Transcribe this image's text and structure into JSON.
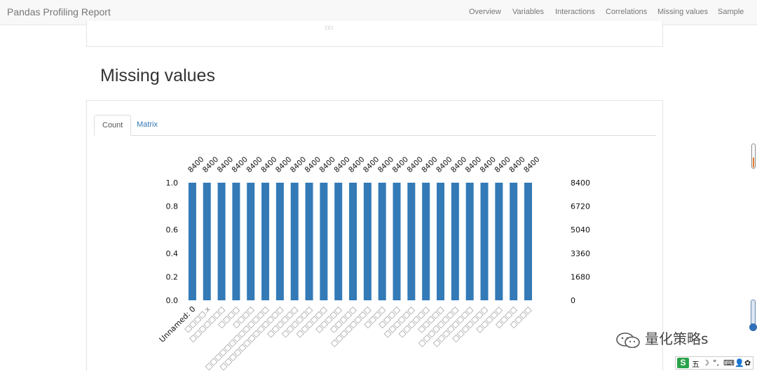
{
  "navbar": {
    "brand": "Pandas Profiling Report",
    "links": [
      "Overview",
      "Variables",
      "Interactions",
      "Correlations",
      "Missing values",
      "Sample"
    ]
  },
  "prev_panel": {
    "tail_text": "□□"
  },
  "section": {
    "title": "Missing values"
  },
  "tabs": [
    {
      "label": "Count",
      "active": true
    },
    {
      "label": "Matrix",
      "active": false
    }
  ],
  "chart_data": {
    "type": "bar",
    "categories": [
      "Unnamed: 0",
      "□□□□.x",
      "□□□□□□□",
      "□□□□",
      "□□□□",
      "□□□□□□□□□□□□□",
      "□□□□□□□□□□□□□",
      "□□□□□□",
      "□□□□□□",
      "□□□□□□",
      "□□□□□",
      "□□□□□",
      "□□□□□□□□",
      "□□□□",
      "□□□□",
      "□□□□□□",
      "□□□□□□",
      "□□□□□",
      "□□□□□□□□",
      "□□□□□□□□",
      "□□□□□□□",
      "□□□□□",
      "□□□□",
      "□□□□"
    ],
    "values": [
      8400,
      8400,
      8400,
      8400,
      8400,
      8400,
      8400,
      8400,
      8400,
      8400,
      8400,
      8400,
      8400,
      8400,
      8400,
      8400,
      8400,
      8400,
      8400,
      8400,
      8400,
      8400,
      8400,
      8400
    ],
    "value_labels": [
      "8400",
      "8400",
      "8400",
      "8400",
      "8400",
      "8400",
      "8400",
      "8400",
      "8400",
      "8400",
      "8400",
      "8400",
      "8400",
      "8400",
      "8400",
      "8400",
      "8400",
      "8400",
      "8400",
      "8400",
      "8400",
      "8400",
      "8400",
      "8400"
    ],
    "left_axis": {
      "ticks": [
        "0.0",
        "0.2",
        "0.4",
        "0.6",
        "0.8",
        "1.0"
      ],
      "range": [
        0,
        1
      ]
    },
    "right_axis": {
      "ticks": [
        "0",
        "1680",
        "3360",
        "5040",
        "6720",
        "8400"
      ],
      "range": [
        0,
        8400
      ]
    },
    "bar_color": "#337ab7",
    "grid": false
  },
  "watermark": {
    "text": "量化策略s"
  },
  "ime": {
    "logo": "S",
    "items": [
      "五",
      "☽",
      "°,",
      "⌨",
      "👤",
      "✿"
    ]
  },
  "colors": {
    "accent": "#337ab7",
    "navbar_bg": "#f8f8f8"
  }
}
